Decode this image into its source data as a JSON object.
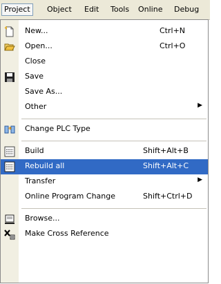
{
  "menubar": {
    "project": "Project",
    "object": "Object",
    "edit": "Edit",
    "tools": "Tools",
    "online": "Online",
    "debug": "Debug"
  },
  "menu": {
    "new": {
      "label": "New...",
      "shortcut": "Ctrl+N"
    },
    "open": {
      "label": "Open...",
      "shortcut": "Ctrl+O"
    },
    "close": {
      "label": "Close"
    },
    "save": {
      "label": "Save"
    },
    "save_as": {
      "label": "Save As..."
    },
    "other": {
      "label": "Other"
    },
    "change_plc": {
      "label": "Change PLC Type"
    },
    "build": {
      "label": "Build",
      "shortcut": "Shift+Alt+B"
    },
    "rebuild_all": {
      "label": "Rebuild all",
      "shortcut": "Shift+Alt+C"
    },
    "transfer": {
      "label": "Transfer"
    },
    "online_change": {
      "label": "Online Program Change",
      "shortcut": "Shift+Ctrl+D"
    },
    "browse": {
      "label": "Browse..."
    },
    "cross_ref": {
      "label": "Make Cross Reference"
    }
  },
  "colors": {
    "highlight": "#316ac5",
    "strip": "#f1efe2",
    "menubar": "#ece9d8"
  }
}
